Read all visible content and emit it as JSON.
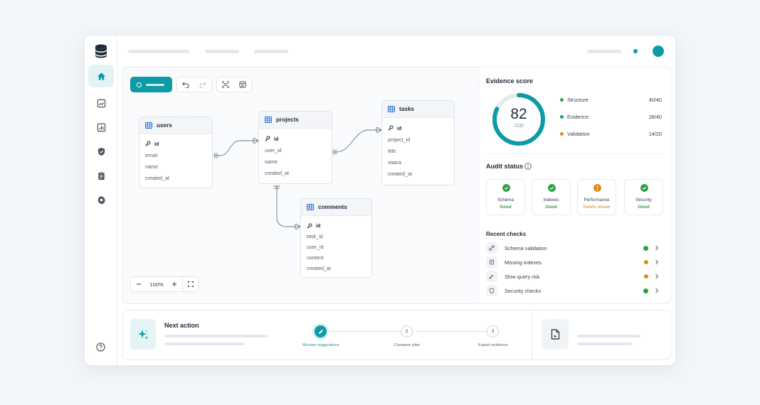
{
  "canvas": {
    "tables": [
      {
        "name": "users",
        "pk": "id",
        "fields": [
          "email",
          "name",
          "created_at"
        ]
      },
      {
        "name": "projects",
        "pk": "id",
        "fields": [
          "user_id",
          "name",
          "created_at"
        ]
      },
      {
        "name": "tasks",
        "pk": "id",
        "fields": [
          "project_id",
          "title",
          "status",
          "created_at"
        ]
      },
      {
        "name": "comments",
        "pk": "id",
        "fields": [
          "task_id",
          "user_id",
          "content",
          "created_at"
        ]
      }
    ],
    "zoom": {
      "level": "100%"
    }
  },
  "evidence": {
    "title": "Evidence score",
    "score": "82",
    "score_max": "/100",
    "score_fraction": 0.82,
    "breakdown": [
      {
        "label": "Structure",
        "value": "40/40",
        "color": "#2ea043"
      },
      {
        "label": "Evidence",
        "value": "28/40",
        "color": "#0e9aa7"
      },
      {
        "label": "Validation",
        "value": "14/20",
        "color": "#e08a16"
      }
    ]
  },
  "audit": {
    "title": "Audit status",
    "cards": [
      {
        "label": "Schema",
        "status": "Good",
        "color": "#2ea043"
      },
      {
        "label": "Indexes",
        "status": "Good",
        "color": "#2ea043"
      },
      {
        "label": "Performance",
        "status": "Needs review",
        "color": "#e08a16"
      },
      {
        "label": "Security",
        "status": "Good",
        "color": "#2ea043"
      }
    ]
  },
  "recent": {
    "title": "Recent checks",
    "items": [
      {
        "label": "Schema validation",
        "icon": "schema-icon",
        "color": "#2ea043"
      },
      {
        "label": "Missing indexes",
        "icon": "index-icon",
        "color": "#e08a16"
      },
      {
        "label": "Slow query risk",
        "icon": "query-icon",
        "color": "#e08a16"
      },
      {
        "label": "Security checks",
        "icon": "shield-icon",
        "color": "#2ea043"
      }
    ]
  },
  "next_action": {
    "title": "Next action",
    "steps": [
      {
        "label": "Review suggestions",
        "number": ""
      },
      {
        "label": "Compare plan",
        "number": "2"
      },
      {
        "label": "Export evidence",
        "number": "3"
      }
    ]
  },
  "colors": {
    "accent": "#0e9aa7",
    "good": "#2ea043",
    "warn": "#e08a16"
  }
}
